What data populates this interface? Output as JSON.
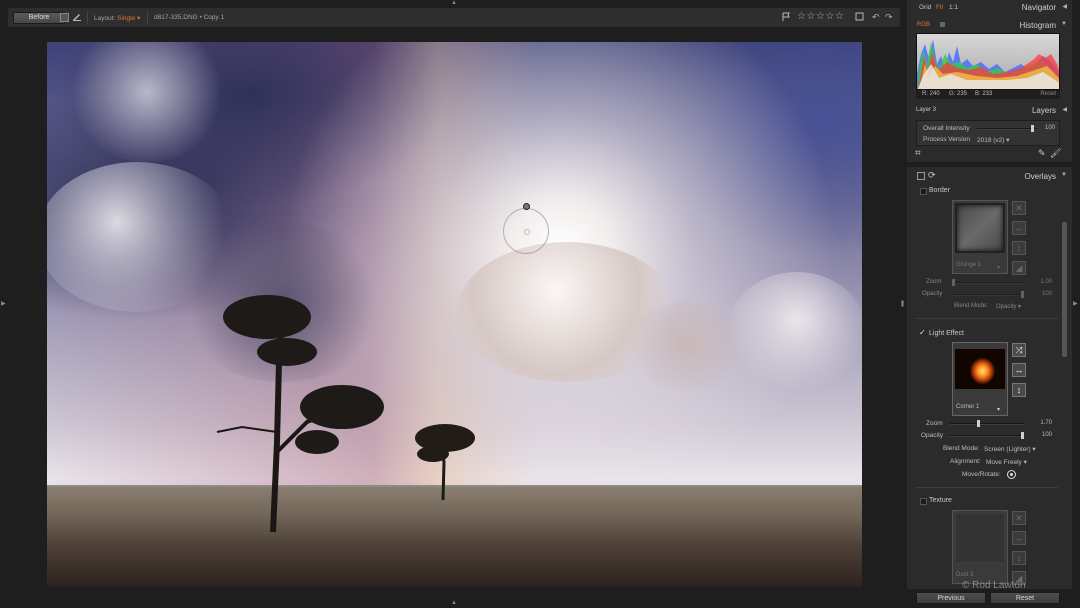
{
  "toolbar": {
    "before_label": "Before",
    "layout_label": "Layout:",
    "layout_value": "Single",
    "filename": "d817-335.DNG • Copy 1",
    "stars": "☆☆☆☆☆"
  },
  "navigator": {
    "grid_label": "Grid",
    "fit_label": "Fit",
    "zoom_1to1": "1:1",
    "title": "Navigator"
  },
  "histogram": {
    "channel": "RGB",
    "title": "Histogram",
    "r_value": "R: 240",
    "g_value": "G: 235",
    "b_value": "B: 233",
    "reset_label": "Reset"
  },
  "layers": {
    "layer_name": "Layer 3",
    "title": "Layers",
    "overall_intensity_label": "Overall Intensity",
    "overall_intensity_value": "100",
    "overall_intensity_level": 0.95,
    "process_version_label": "Process Version",
    "process_version_value": "2018 (v2)"
  },
  "overlays": {
    "title": "Overlays",
    "border": {
      "label": "Border",
      "preset": "Grunge 1",
      "zoom_label": "Zoom",
      "zoom_value": "1.00",
      "opacity_label": "Opacity",
      "opacity_value": "100",
      "blend_label": "Blend Mode:",
      "blend_value": "Opacity"
    },
    "light_effect": {
      "label": "Light Effect",
      "preset": "Corner 1",
      "zoom_label": "Zoom",
      "zoom_value": "1.70",
      "opacity_label": "Opacity",
      "opacity_value": "100",
      "blend_label": "Blend Mode:",
      "blend_value": "Screen (Lighter)",
      "alignment_label": "Alignment:",
      "alignment_value": "Move Freely",
      "move_label": "Move/Rotate:"
    },
    "texture": {
      "label": "Texture",
      "preset": "Dust 3"
    }
  },
  "footer": {
    "previous_label": "Previous",
    "reset_label": "Reset"
  },
  "watermark": "© Rod Lawton",
  "colors": {
    "accent": "#e4733a",
    "panel": "#2b2b2b",
    "background": "#1e1e1e"
  }
}
